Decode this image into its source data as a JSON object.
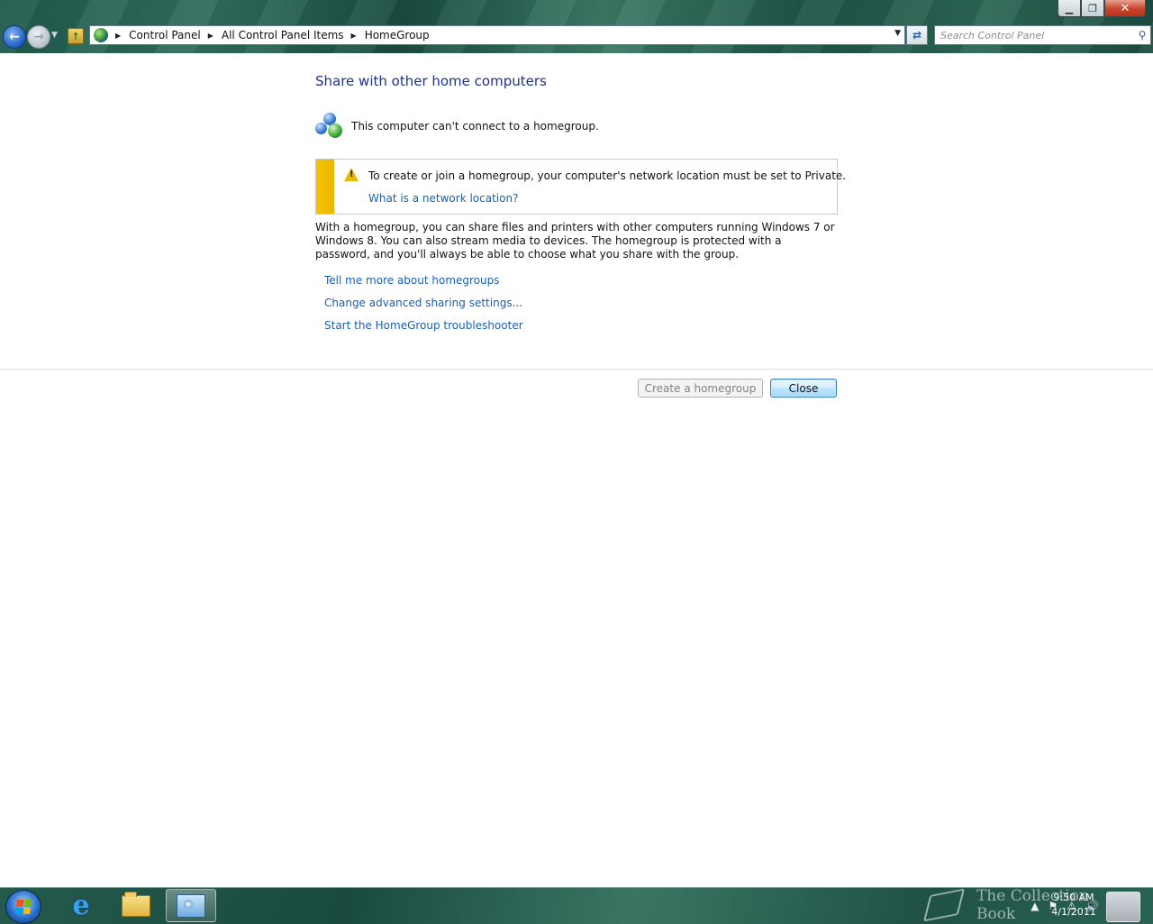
{
  "window": {
    "controls": {
      "minimize": "▁",
      "restore": "❐",
      "close": "✕"
    }
  },
  "navigation": {
    "back_icon": "back-arrow-icon",
    "forward_icon": "forward-arrow-icon",
    "up_icon": "up-folder-icon"
  },
  "address": {
    "breadcrumbs": [
      "Control Panel",
      "All Control Panel Items",
      "HomeGroup"
    ]
  },
  "search": {
    "placeholder": "Search Control Panel"
  },
  "main": {
    "heading": "Share with other home computers",
    "status": "This computer can't connect to a homegroup.",
    "alert": {
      "message": "To create or join a homegroup, your computer's network location must be set to Private.",
      "link": "What is a network location?",
      "accent_color": "#f5c400"
    },
    "description": "With a homegroup, you can share files and printers with other computers running Windows 7 or Windows 8. You can also stream media to devices. The homegroup is protected with a password, and you'll always be able to choose what you share with the group.",
    "links": [
      "Tell me more about homegroups",
      "Change advanced sharing settings...",
      "Start the HomeGroup troubleshooter"
    ],
    "buttons": {
      "create": "Create a homegroup",
      "close": "Close"
    }
  },
  "taskbar": {
    "apps": [
      "internet-explorer-icon",
      "file-explorer-icon",
      "control-panel-icon"
    ],
    "clock": {
      "time": "9:50 AM",
      "date": "4/1/2011"
    },
    "watermark": "The Collection Book"
  },
  "colors": {
    "heading": "#1e3287",
    "link": "#1a5fb4",
    "alert_stripe": "#f5c400"
  }
}
